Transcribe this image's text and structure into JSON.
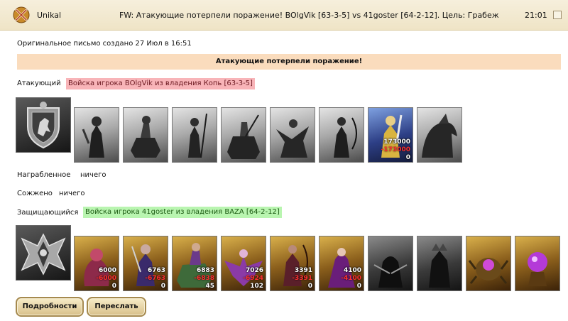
{
  "header": {
    "sender": "Unikal",
    "subject": "FW: Атакующие потерпели поражение! BOlgVik [63-3-5] vs 41goster [64-2-12]. Цель: Грабеж",
    "time": "21:01"
  },
  "message": {
    "created": "Оригинальное письмо создано 27 Июл в 16:51",
    "result_banner": "Атакующие потерпели поражение!"
  },
  "attacker": {
    "label": "Атакующий",
    "army": "Войска игрока BOlgVik из владения Копь [63-3-5]",
    "emblem_icon": "lion-shield-icon",
    "units": [
      {
        "icon": "ranger-unit-icon",
        "style": "gray",
        "count": "",
        "loss": "",
        "left": ""
      },
      {
        "icon": "barbarian-rider-unit-icon",
        "style": "gray",
        "count": "",
        "loss": "",
        "left": ""
      },
      {
        "icon": "spearman-unit-icon",
        "style": "gray",
        "count": "",
        "loss": "",
        "left": ""
      },
      {
        "icon": "knight-unit-icon",
        "style": "gray",
        "count": "",
        "loss": "",
        "left": ""
      },
      {
        "icon": "pegasus-unit-icon",
        "style": "gray",
        "count": "",
        "loss": "",
        "left": ""
      },
      {
        "icon": "archer-unit-icon",
        "style": "gray",
        "count": "",
        "loss": "",
        "left": ""
      },
      {
        "icon": "monk-unit-icon",
        "style": "gray",
        "count": "",
        "loss": "",
        "left": ""
      },
      {
        "icon": "swordsman-unit-icon",
        "style": "blue",
        "count": "173000",
        "loss": "-173000",
        "left": "0"
      },
      {
        "icon": "dragon-unit-icon",
        "style": "gray",
        "count": "",
        "loss": "",
        "left": ""
      }
    ]
  },
  "loot": {
    "label": "Награбленное",
    "value": "ничего"
  },
  "burned": {
    "label": "Сожжено",
    "value": "ничего"
  },
  "defender": {
    "label": "Защищающийся",
    "army": "Войска игрока 41goster из владения BAZA [64-2-12]",
    "emblem_icon": "bat-wing-shield-icon",
    "units": [
      {
        "icon": "imp-unit-icon",
        "style": "gold",
        "count": "6000",
        "loss": "-6000",
        "left": "0"
      },
      {
        "icon": "dark-elf-unit-icon",
        "style": "gold",
        "count": "6763",
        "loss": "-6763",
        "left": "0"
      },
      {
        "icon": "lizard-rider-unit-icon",
        "style": "gold",
        "count": "6883",
        "loss": "-6838",
        "left": "45"
      },
      {
        "icon": "harpy-unit-icon",
        "style": "gold",
        "count": "7026",
        "loss": "-6924",
        "left": "102"
      },
      {
        "icon": "dark-archer-unit-icon",
        "style": "gold",
        "count": "3391",
        "loss": "-3391",
        "left": "0"
      },
      {
        "icon": "sorceress-unit-icon",
        "style": "gold",
        "count": "4100",
        "loss": "-4100",
        "left": "0"
      },
      {
        "icon": "assassin-unit-icon",
        "style": "dark",
        "count": "",
        "loss": "",
        "left": ""
      },
      {
        "icon": "dark-knight-unit-icon",
        "style": "dark",
        "count": "",
        "loss": "",
        "left": ""
      },
      {
        "icon": "spider-idol-icon",
        "style": "gold",
        "count": "",
        "loss": "",
        "left": ""
      },
      {
        "icon": "magic-orb-icon",
        "style": "gold",
        "count": "",
        "loss": "",
        "left": ""
      }
    ]
  },
  "buttons": {
    "details": "Подробности",
    "forward": "Переслать"
  }
}
